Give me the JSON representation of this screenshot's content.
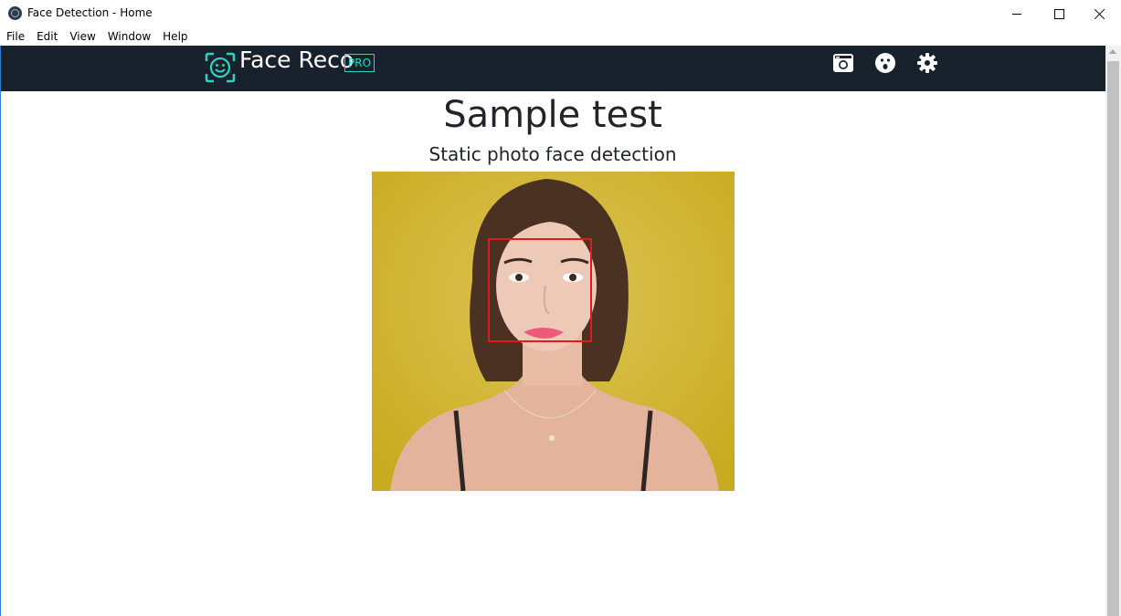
{
  "window": {
    "title": "Face Detection - Home",
    "icon": "electron-app-icon"
  },
  "menu": {
    "items": [
      "File",
      "Edit",
      "View",
      "Window",
      "Help"
    ]
  },
  "navbar": {
    "brand": "Face Reco",
    "badge": "PRO",
    "icons": [
      "camera-icon",
      "surprised-face-icon",
      "settings-gear-icon"
    ],
    "colors": {
      "background": "#18222c",
      "accent": "#2ed3c6"
    }
  },
  "main": {
    "title": "Sample test",
    "subtitle": "Static photo face detection",
    "image": {
      "subject": "woman portrait on yellow background",
      "detection_box_color": "#e11a1a"
    }
  }
}
